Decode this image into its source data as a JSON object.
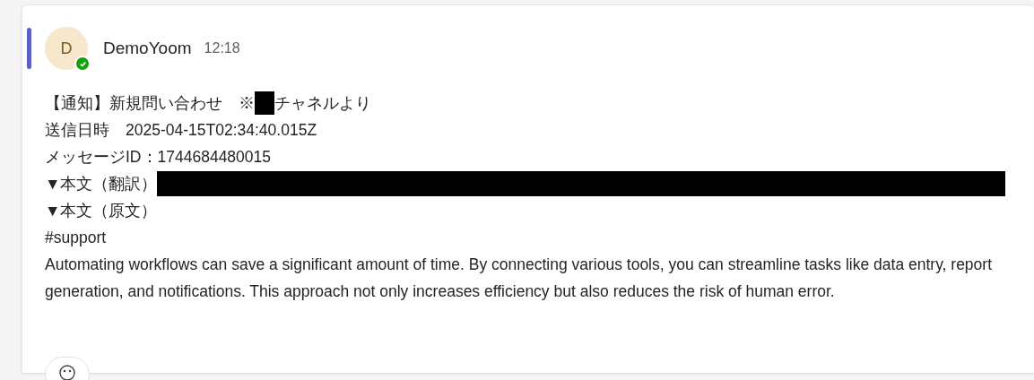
{
  "message": {
    "author": "DemoYoom",
    "time": "12:18",
    "avatar_initial": "D",
    "online": true,
    "lines": [
      {
        "segments": [
          {
            "kind": "text",
            "text": "【通知】新規問い合わせ　※"
          },
          {
            "kind": "mask"
          },
          {
            "kind": "text",
            "text": "チャネルより"
          }
        ]
      },
      {
        "segments": [
          {
            "kind": "text",
            "text": "送信日時　2025-04-15T02:34:40.015Z"
          }
        ]
      },
      {
        "segments": [
          {
            "kind": "text",
            "text": "メッセージID：1744684480015"
          }
        ]
      },
      {
        "segments": [
          {
            "kind": "text",
            "text": "▼本文（翻訳）"
          },
          {
            "kind": "bar"
          }
        ]
      },
      {
        "segments": [
          {
            "kind": "text",
            "text": "▼本文（原文）"
          }
        ]
      },
      {
        "segments": [
          {
            "kind": "text",
            "text": "#support"
          }
        ]
      },
      {
        "segments": [
          {
            "kind": "text",
            "text": "Automating workflows can save a significant amount of time. By connecting various tools, you can streamline tasks like data entry, report generation, and notifications. This approach not only increases efficiency but also reduces the risk of human error."
          }
        ]
      }
    ]
  }
}
